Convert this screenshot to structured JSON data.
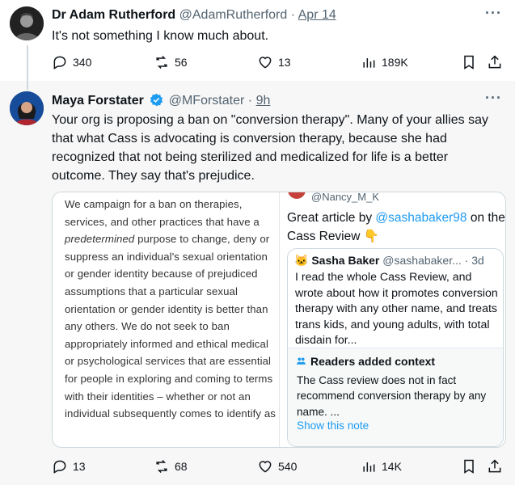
{
  "tweet1": {
    "name": "Dr Adam Rutherford",
    "handle": "@AdamRutherford",
    "separator": "·",
    "date": "Apr 14",
    "text": "It's not something I know much about.",
    "actions": {
      "replies": "340",
      "retweets": "56",
      "likes": "13",
      "views": "189K"
    }
  },
  "tweet2": {
    "name": "Maya Forstater",
    "handle": "@MForstater",
    "separator": "·",
    "date": "9h",
    "text": "Your org is proposing a ban on \"conversion therapy\". Many of your allies say that what Cass is advocating is conversion therapy, because she had recognized that not being sterilized and medicalized for life is a better outcome.  They say that's prejudice.",
    "quote_left": {
      "part1": "We campaign for a ban on therapies, services, and other practices that have a ",
      "emphasis": "predetermined",
      "part2": " purpose to change, deny or suppress an individual's sexual orientation or gender identity because of prejudiced assumptions that a particular sexual orientation or gender identity is better than any others. We do not seek to ban appropriately informed and ethical medical or psychological services that are essential for people in exploring and coming to terms with their identities – whether or not an individual subsequently comes to identify as"
    },
    "quote_right": {
      "handle": "@Nancy_M_K",
      "text_before": "Great article by ",
      "mention": "@sashabaker98",
      "text_after": " on the Cass Review 👇",
      "inner": {
        "name": "Sasha Baker",
        "handle": "@sashabaker...",
        "separator": "·",
        "date": "3d",
        "text": "I read the whole Cass Review, and wrote about how it promotes conversion therapy with any other name, and treats trans kids, and young adults, with total disdain for...",
        "context_title": "Readers added context",
        "context_text": "The Cass review does not in fact recommend conversion therapy by any name. ...",
        "show_note": "Show this note"
      }
    },
    "actions": {
      "replies": "13",
      "retweets": "68",
      "likes": "540",
      "views": "14K"
    }
  },
  "colors": {
    "link": "#1d9bf0",
    "secondary": "#536471",
    "verified": "#1d9bf0"
  },
  "more_glyph": "···"
}
